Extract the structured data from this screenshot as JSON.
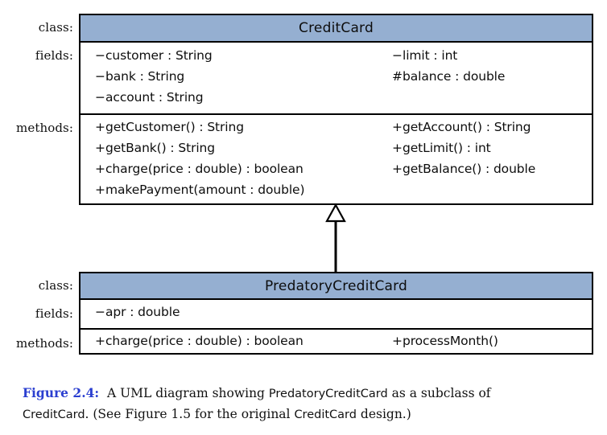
{
  "figure": {
    "gutter_labels": {
      "class": "class:",
      "fields": "fields:",
      "methods": "methods:"
    },
    "colors": {
      "header_fill": "#95afd1",
      "border": "#000000",
      "caption_accent": "#2b3fd0",
      "text": "#0d0d0d"
    },
    "superclass": {
      "name": "CreditCard",
      "fields": {
        "column_left": [
          {
            "visibility": "−",
            "text": "customer : String"
          },
          {
            "visibility": "−",
            "text": "bank : String"
          },
          {
            "visibility": "−",
            "text": "account : String"
          }
        ],
        "column_right": [
          {
            "visibility": "−",
            "text": "limit : int"
          },
          {
            "visibility": "#",
            "text": "balance : double"
          }
        ]
      },
      "methods": {
        "column_left": [
          {
            "visibility": "+",
            "text": "getCustomer() : String"
          },
          {
            "visibility": "+",
            "text": "getBank() : String"
          },
          {
            "visibility": "+",
            "text": "charge(price : double) : boolean"
          },
          {
            "visibility": "+",
            "text": "makePayment(amount : double)"
          }
        ],
        "column_right": [
          {
            "visibility": "+",
            "text": "getAccount() : String"
          },
          {
            "visibility": "+",
            "text": "getLimit() : int"
          },
          {
            "visibility": "+",
            "text": "getBalance() : double"
          }
        ]
      }
    },
    "subclass": {
      "name": "PredatoryCreditCard",
      "fields": {
        "column_left": [
          {
            "visibility": "−",
            "text": "apr : double"
          }
        ],
        "column_right": []
      },
      "methods": {
        "column_left": [
          {
            "visibility": "+",
            "text": "charge(price : double) : boolean"
          }
        ],
        "column_right": [
          {
            "visibility": "+",
            "text": "processMonth()"
          }
        ]
      }
    },
    "relationship": {
      "kind": "generalization",
      "arrowhead": "hollow-triangle",
      "from": "PredatoryCreditCard",
      "to": "CreditCard"
    },
    "caption": {
      "number": "Figure 2.4:",
      "line1_a": "A UML diagram showing ",
      "line1_code": "PredatoryCreditCard",
      "line1_b": " as a subclass of",
      "line2_code1": "CreditCard",
      "line2_a": ". (See Figure 1.5 for the original ",
      "line2_code2": "CreditCard",
      "line2_b": " design.)"
    }
  }
}
